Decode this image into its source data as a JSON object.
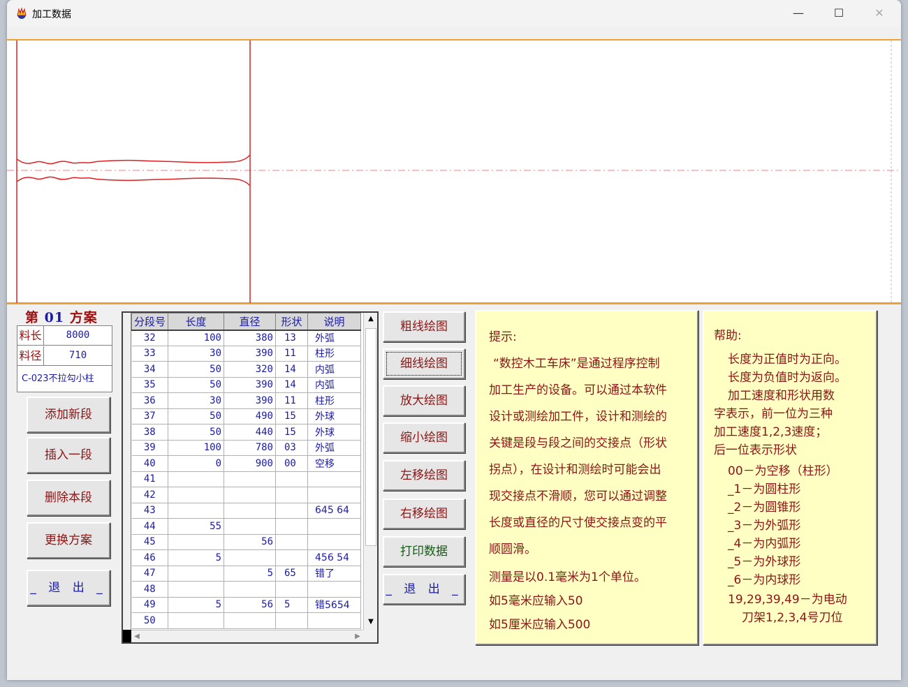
{
  "window": {
    "title": "加工数据",
    "minimize": "—",
    "maximize": "☐",
    "close": "✕"
  },
  "scheme": {
    "prefix": "第",
    "number": "01",
    "suffix": "方案",
    "params": [
      {
        "label": "料长",
        "value": "8000"
      },
      {
        "label": "料径",
        "value": "710"
      }
    ],
    "description": "C-023不拉勾小柱"
  },
  "left_buttons": {
    "add": "添加新段",
    "insert": "插入一段",
    "delete": "删除本段",
    "change": "更换方案",
    "exit": "_ 退 出 _"
  },
  "grid": {
    "headers": [
      "分段号",
      "长度",
      "直径",
      "形状",
      "说明"
    ],
    "rows": [
      [
        "32",
        "100",
        "380",
        "13",
        "外弧"
      ],
      [
        "33",
        "30",
        "390",
        "11",
        "柱形"
      ],
      [
        "34",
        "50",
        "320",
        "14",
        "内弧"
      ],
      [
        "35",
        "50",
        "390",
        "14",
        "内弧"
      ],
      [
        "36",
        "30",
        "390",
        "11",
        "柱形"
      ],
      [
        "37",
        "50",
        "490",
        "15",
        "外球"
      ],
      [
        "38",
        "50",
        "440",
        "15",
        "外球"
      ],
      [
        "39",
        "100",
        "780",
        "03",
        "外弧"
      ],
      [
        "40",
        "0",
        "900",
        "00",
        "空移"
      ],
      [
        "41",
        "",
        "",
        "",
        ""
      ],
      [
        "42",
        "",
        "",
        "",
        ""
      ],
      [
        "43",
        "",
        "",
        "",
        "645 64"
      ],
      [
        "44",
        "55",
        "",
        "",
        ""
      ],
      [
        "45",
        "",
        "56",
        "",
        ""
      ],
      [
        "46",
        "5",
        "",
        "",
        "456 54"
      ],
      [
        "47",
        "",
        "5",
        "65",
        "错了"
      ],
      [
        "48",
        "",
        "",
        "",
        ""
      ],
      [
        "49",
        "5",
        "56",
        "5",
        "错5654"
      ],
      [
        "50",
        "",
        "",
        "",
        ""
      ]
    ]
  },
  "mid_buttons": {
    "thick": "粗线绘图",
    "thin": "细线绘图",
    "zoom_in": "放大绘图",
    "zoom_out": "缩小绘图",
    "left": "左移绘图",
    "right": "右移绘图",
    "print": "打印数据",
    "exit": "_ 退 出 _"
  },
  "tip": {
    "heading": "提示:",
    "lines": [
      "“数控木工车床”是通过程序控制",
      "加工生产的设备。可以通过本软件",
      "设计或测绘加工件，设计和测绘的",
      "关键是段与段之间的交接点（形状",
      "拐点），在设计和测绘时可能会出",
      "现交接点不滑顺，您可以通过调整",
      "长度或直径的尺寸使交接点变的平",
      "顺圆滑。"
    ],
    "measure": "测量是以0.1毫米为1个单位。",
    "example1": "如5毫米应输入50",
    "example2": "如5厘米应输入500"
  },
  "help": {
    "heading": "帮助:",
    "lines": [
      "长度为正值时为正向。",
      "长度为负值时为返向。",
      "加工速度和形状用数",
      "字表示，前一位为三种",
      "加工速度1,2,3速度；",
      "后一位表示形状",
      "00－为空移（柱形）",
      "_1－为圆柱形",
      "_2－为圆锥形",
      "_3－为外弧形",
      "_4－为内弧形",
      "_5－为外球形",
      "_6－为内球形",
      "19,29,39,49－为电动",
      "刀架1,2,3,4号刀位"
    ]
  },
  "colors": {
    "accent_orange": "#f0a030",
    "profile_red": "#e02020",
    "label_red": "#8b1515",
    "value_blue": "#1a1aa8",
    "note_bg": "#ffffc4"
  }
}
